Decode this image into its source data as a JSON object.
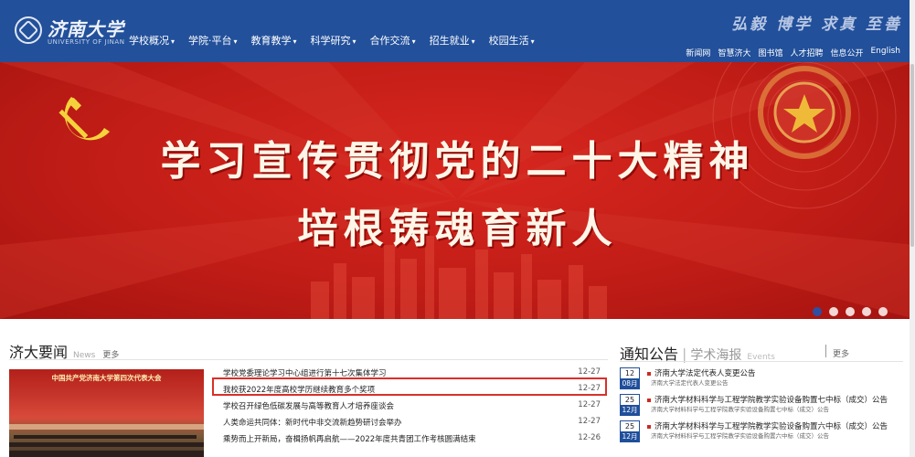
{
  "header": {
    "logo_cn": "济南大学",
    "logo_en": "UNIVERSITY OF JINAN",
    "nav": [
      {
        "label": "学校概况"
      },
      {
        "label": "学院·平台"
      },
      {
        "label": "教育教学"
      },
      {
        "label": "科学研究"
      },
      {
        "label": "合作交流"
      },
      {
        "label": "招生就业"
      },
      {
        "label": "校园生活"
      }
    ],
    "motto": "弘毅 博学 求真 至善",
    "top_links": [
      {
        "label": "新闻网"
      },
      {
        "label": "智慧济大"
      },
      {
        "label": "图书馆"
      },
      {
        "label": "人才招聘"
      },
      {
        "label": "信息公开"
      },
      {
        "label": "English"
      }
    ],
    "colors": {
      "bar": "#22509b",
      "banner": "#c21d17",
      "accent": "#d9302a"
    }
  },
  "banner": {
    "line1": "学习宣传贯彻党的二十大精神",
    "line2": "培根铸魂育新人",
    "slides": 5,
    "active_slide": 1
  },
  "news": {
    "title": "济大要闻",
    "title_en": "News",
    "more": "更多",
    "photo_caption": "中国共产党济南大学第四次代表大会",
    "items": [
      {
        "title": "学校党委理论学习中心组进行第十七次集体学习",
        "date": "12-27"
      },
      {
        "title": "我校获2022年度高校学历继续教育多个奖项",
        "date": "12-27"
      },
      {
        "title": "学校召开绿色低碳发展与高等教育人才培养座谈会",
        "date": "12-27"
      },
      {
        "title": "人类命运共同体：新时代中非交流新趋势研讨会举办",
        "date": "12-27"
      },
      {
        "title": "乘势而上开新局，奋楫扬帆再启航——2022年度共青团工作考核圆满结束",
        "date": "12-26"
      }
    ]
  },
  "notices": {
    "title": "通知公告",
    "tab2": "学术海报",
    "tab2_en": "Events",
    "more": "更多",
    "items": [
      {
        "day": "12",
        "month": "08月",
        "title": "济南大学法定代表人变更公告",
        "subtitle": "济南大学法定代表人变更公告"
      },
      {
        "day": "25",
        "month": "12月",
        "title": "济南大学材料科学与工程学院教学实验设备购置七中标（成交）公告",
        "subtitle": "济南大学材料科学与工程学院教学实验设备购置七中标（成交）公告"
      },
      {
        "day": "25",
        "month": "12月",
        "title": "济南大学材料科学与工程学院教学实验设备购置六中标（成交）公告",
        "subtitle": "济南大学材料科学与工程学院教学实验设备购置六中标（成交）公告"
      }
    ]
  }
}
